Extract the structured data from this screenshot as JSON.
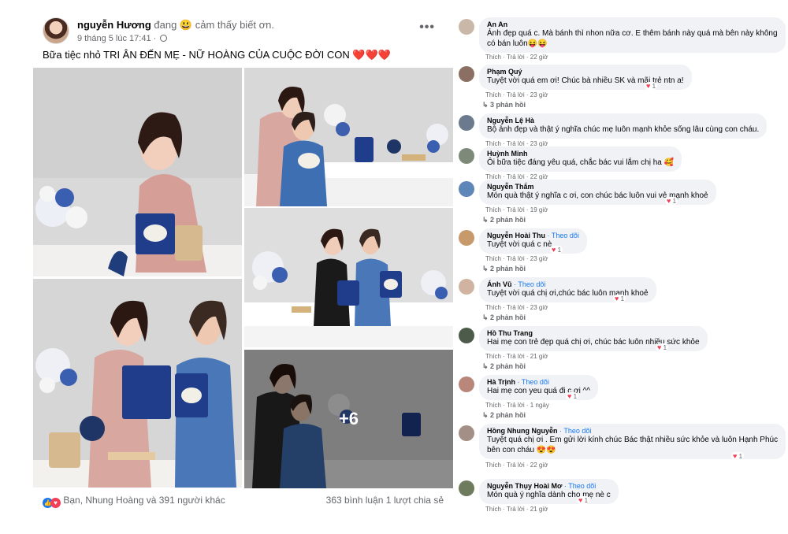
{
  "post": {
    "author": "nguyễn Hương",
    "feeling": "đang 😃 cảm thấy biết ơn.",
    "timestamp": "9 tháng 5 lúc 17:41 ·",
    "more_icon": "more-horizontal-icon",
    "text": "Bữa tiệc nhỏ TRI ÂN ĐẾN MẸ - NỮ HOÀNG CỦA CUỘC ĐỜI CON",
    "hearts": "❤️❤️❤️",
    "extra_photos": "+6",
    "reactions_text": "Bạn, Nhung Hoàng và 391 người khác",
    "stats": "363 bình luận  1 lượt chia sẻ",
    "colors": {
      "like": "#1877f2",
      "love": "#f33e58"
    }
  },
  "comments": [
    {
      "name": "An An",
      "follow": "",
      "lines": [
        "Ảnh đẹp quá c. Mà bánh thì nhon nữa cơ. E thêm bánh này quá mà bên này không",
        "có bán luôn😝😝"
      ],
      "actions": "Thích · Trả lời · 22 giờ",
      "react": "",
      "replies": ""
    },
    {
      "name": "Phạm Quý",
      "follow": "",
      "lines": [
        "Tuyệt vời quá em ơi! Chúc bà nhiều SK và mãi trẻ ntn a!"
      ],
      "actions": "Thích · Trả lời · 23 giờ",
      "react": "1",
      "replies": "↳ 3 phản hồi"
    },
    {
      "name": "Nguyễn Lệ Hà",
      "follow": "",
      "lines": [
        "Bộ ảnh đẹp và thật ý nghĩa chúc mẹ luôn mạnh khỏe sống lâu cùng con cháu."
      ],
      "actions": "Thích · Trả lời · 23 giờ",
      "react": "",
      "replies": ""
    },
    {
      "name": "Huỳnh Minh",
      "follow": "",
      "lines": [
        "Ôi bữa tiệc đáng yêu quá, chắc bác vui lắm chị ha 🥰"
      ],
      "actions": "Thích · Trả lời · 22 giờ",
      "react": "",
      "replies": ""
    },
    {
      "name": "Nguyễn Thắm",
      "follow": "",
      "lines": [
        "Món quà thật ý nghĩa c ơi, con chúc bác luôn vui vẻ mạnh khoẻ"
      ],
      "actions": "Thích · Trả lời · 19 giờ",
      "react": "1",
      "replies": "↳ 2 phản hồi"
    },
    {
      "name": "Nguyễn Hoài Thu",
      "follow": "· Theo dõi",
      "lines": [
        "Tuyệt vời quá c nè"
      ],
      "actions": "Thích · Trả lời · 23 giờ",
      "react": "1",
      "replies": "↳ 2 phản hồi"
    },
    {
      "name": "Ánh Vũ",
      "follow": "· Theo dõi",
      "lines": [
        "Tuyệt vời quá chị ơi,chúc bác luôn mạnh khoẻ"
      ],
      "actions": "Thích · Trả lời · 23 giờ",
      "react": "1",
      "replies": "↳ 2 phản hồi"
    },
    {
      "name": "Hồ Thu Trang",
      "follow": "",
      "lines": [
        "Hai mẹ con trẻ đẹp quá chị ơi, chúc bác luôn nhiều sức khỏe"
      ],
      "actions": "Thích · Trả lời · 21 giờ",
      "react": "1",
      "replies": "↳ 2 phản hồi"
    },
    {
      "name": "Hà Trịnh",
      "follow": "· Theo dõi",
      "lines": [
        "Hai mẹ con yeu quá đi c ơi ^^"
      ],
      "actions": "Thích · Trả lời · 1 ngày",
      "react": "1",
      "replies": "↳ 2 phản hồi"
    },
    {
      "name": "Hồng Nhung Nguyễn",
      "follow": "· Theo dõi",
      "lines": [
        "Tuyệt quá chị ơi . Em gửi lời kính chúc Bác thật nhiều sức khỏe và luôn Hạnh Phúc",
        "bên con cháu 😍😍"
      ],
      "actions": "Thích · Trả lời · 22 giờ",
      "react": "1",
      "replies": ""
    },
    {
      "name": "Nguyễn Thụy Hoài Mơ",
      "follow": "· Theo dõi",
      "lines": [
        "Món quà ý nghĩa dành cho mẹ nè c"
      ],
      "actions": "Thích · Trả lời · 21 giờ",
      "react": "1",
      "replies": ""
    }
  ]
}
